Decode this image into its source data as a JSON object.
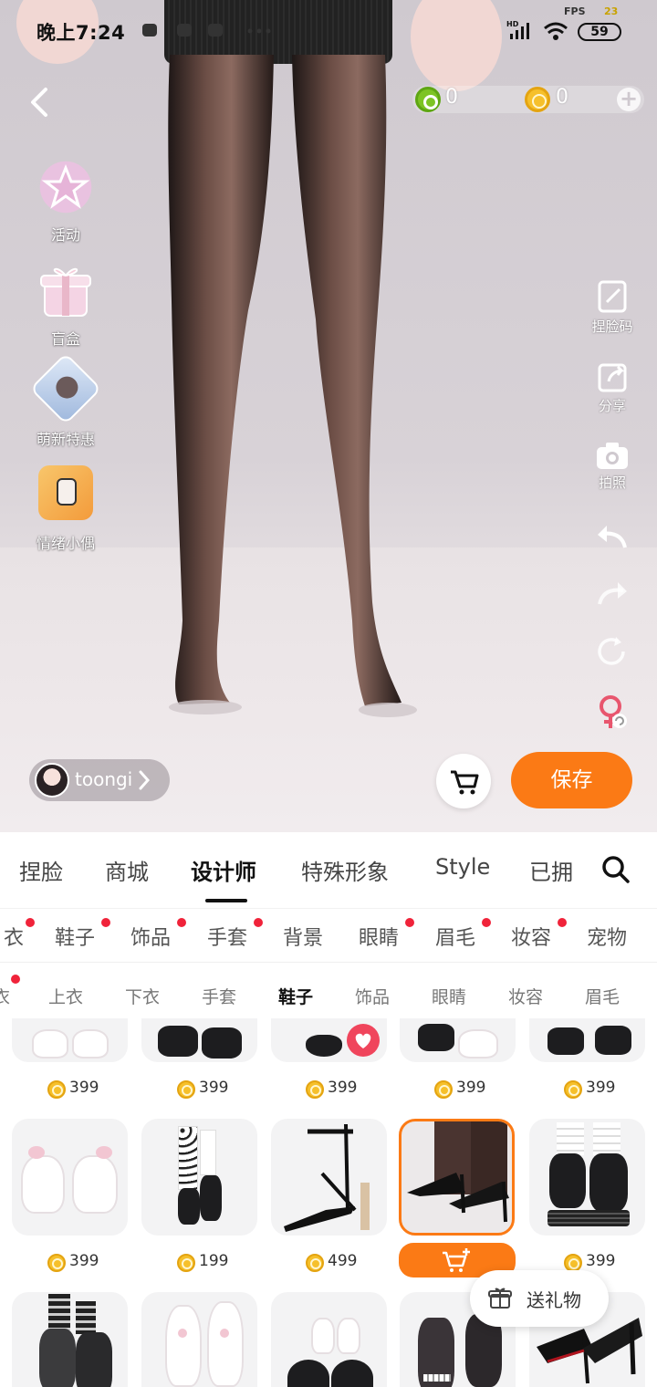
{
  "status_bar": {
    "time": "晚上7:24",
    "battery": "59",
    "fps_label": "FPS",
    "fps_value": "23"
  },
  "currency": {
    "green_value": "0",
    "gold_value": "0"
  },
  "side_menu": [
    {
      "label": "活动",
      "icon": "star-badge-icon"
    },
    {
      "label": "盲盒",
      "icon": "gift-box-icon"
    },
    {
      "label": "萌新特惠",
      "icon": "newbie-deal-icon"
    },
    {
      "label": "情绪小偶",
      "icon": "emotion-doll-icon"
    }
  ],
  "right_tools": [
    {
      "label": "捏脸码",
      "icon": "face-code-icon"
    },
    {
      "label": "分享",
      "icon": "share-icon"
    },
    {
      "label": "拍照",
      "icon": "camera-icon"
    },
    {
      "label": "",
      "icon": "undo-icon"
    },
    {
      "label": "",
      "icon": "redo-icon"
    },
    {
      "label": "",
      "icon": "reset-icon"
    },
    {
      "label": "",
      "icon": "gender-switch-icon"
    }
  ],
  "user": {
    "name": "toongi"
  },
  "actions": {
    "save_label": "保存"
  },
  "main_tabs": [
    {
      "label": "捏脸",
      "active": false
    },
    {
      "label": "商城",
      "active": false
    },
    {
      "label": "设计师",
      "active": true
    },
    {
      "label": "特殊形象",
      "active": false
    },
    {
      "label": "Style",
      "active": false
    },
    {
      "label": "已拥",
      "active": false
    }
  ],
  "sub_tabs": [
    {
      "label": "衣",
      "dot": true
    },
    {
      "label": "鞋子",
      "dot": true
    },
    {
      "label": "饰品",
      "dot": true
    },
    {
      "label": "手套",
      "dot": true
    },
    {
      "label": "背景",
      "dot": false
    },
    {
      "label": "眼睛",
      "dot": true
    },
    {
      "label": "眉毛",
      "dot": true
    },
    {
      "label": "妆容",
      "dot": true
    },
    {
      "label": "宠物",
      "dot": false
    }
  ],
  "third_tabs": [
    {
      "label": "衣",
      "active": false
    },
    {
      "label": "上衣",
      "active": false
    },
    {
      "label": "下衣",
      "active": false
    },
    {
      "label": "手套",
      "active": false
    },
    {
      "label": "鞋子",
      "active": true
    },
    {
      "label": "饰品",
      "active": false
    },
    {
      "label": "眼睛",
      "active": false
    },
    {
      "label": "妆容",
      "active": false
    },
    {
      "label": "眉毛",
      "active": false
    }
  ],
  "items_row1_prices": [
    "399",
    "399",
    "399",
    "399",
    "399"
  ],
  "items_row2": [
    {
      "price": "399",
      "desc": "white bow platform boots"
    },
    {
      "price": "199",
      "desc": "polka dot socks black boots"
    },
    {
      "price": "499",
      "desc": "black strappy heels"
    },
    {
      "price": null,
      "desc": "black pointed pumps",
      "selected": true
    },
    {
      "price": "399",
      "desc": "black layered boots"
    }
  ],
  "gift": {
    "label": "送礼物"
  },
  "colors": {
    "accent": "#fb7a15",
    "badge": "#f0233a",
    "favorite": "#f0455c"
  }
}
